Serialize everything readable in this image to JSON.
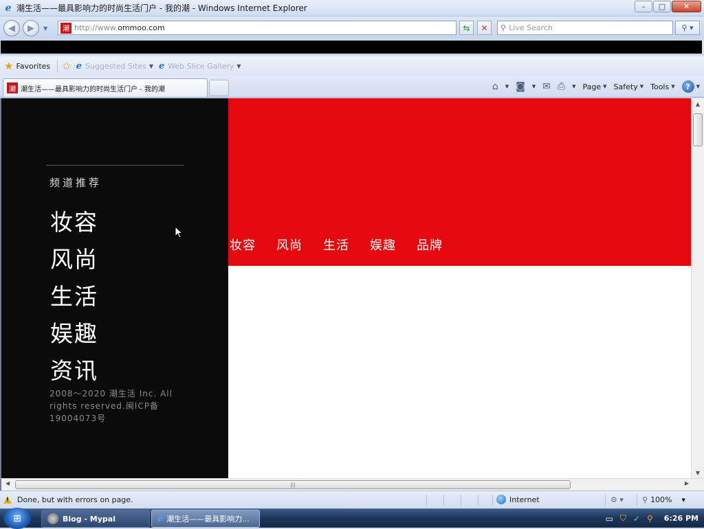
{
  "window": {
    "title": "潮生活——最具影响力的时尚生活门户 - 我的潮 - Windows Internet Explorer",
    "buttons": {
      "minimize": "–",
      "maximize": "□",
      "close": "✕"
    }
  },
  "address": {
    "url_prefix": "http://www.",
    "url_domain": "ommoo.com",
    "favicon_text": "潮"
  },
  "search": {
    "placeholder": "Live Search"
  },
  "favorites_bar": {
    "label": "Favorites",
    "items": [
      {
        "label": "Suggested Sites"
      },
      {
        "label": "Web Slice Gallery"
      }
    ]
  },
  "tabs": [
    {
      "label": "潮生活——最具影响力的时尚生活门户 - 我的潮"
    }
  ],
  "command_bar": {
    "page": "Page",
    "safety": "Safety",
    "tools": "Tools",
    "help": "?"
  },
  "page": {
    "sidebar": {
      "section_title": "频道推荐",
      "items": [
        "妆容",
        "风尚",
        "生活",
        "娱趣",
        "资讯"
      ],
      "copyright": "2008～2020 潮生活 Inc. All rights reserved.闽ICP备19004073号"
    },
    "banner": {
      "nav": [
        "妆容",
        "风尚",
        "生活",
        "娱趣",
        "品牌"
      ],
      "color": "#e5090f"
    }
  },
  "status_bar": {
    "message": "Done, but with errors on page.",
    "zone": "Internet",
    "zoom": "100%"
  },
  "taskbar": {
    "tasks": [
      {
        "label": "Blog - Mypal"
      },
      {
        "label": "潮生活——最具影响力..."
      }
    ],
    "clock": "6:26 PM"
  }
}
